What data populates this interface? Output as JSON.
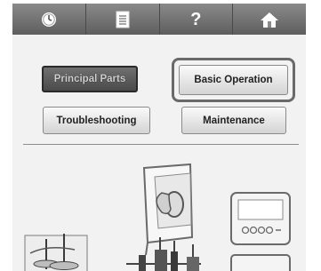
{
  "topbar": {
    "tabs": [
      {
        "icon": "clock-icon"
      },
      {
        "icon": "document-icon"
      },
      {
        "icon": "question-icon",
        "glyph": "?"
      },
      {
        "icon": "home-icon"
      }
    ]
  },
  "buttons": {
    "principal_parts": "Principal Parts",
    "basic_operation": "Basic Operation",
    "troubleshooting": "Troubleshooting",
    "maintenance": "Maintenance"
  },
  "colors": {
    "tab_bar": "#6e6e6e",
    "selected_button": "#4a4a4a",
    "selection_frame": "#6a6a6a"
  }
}
